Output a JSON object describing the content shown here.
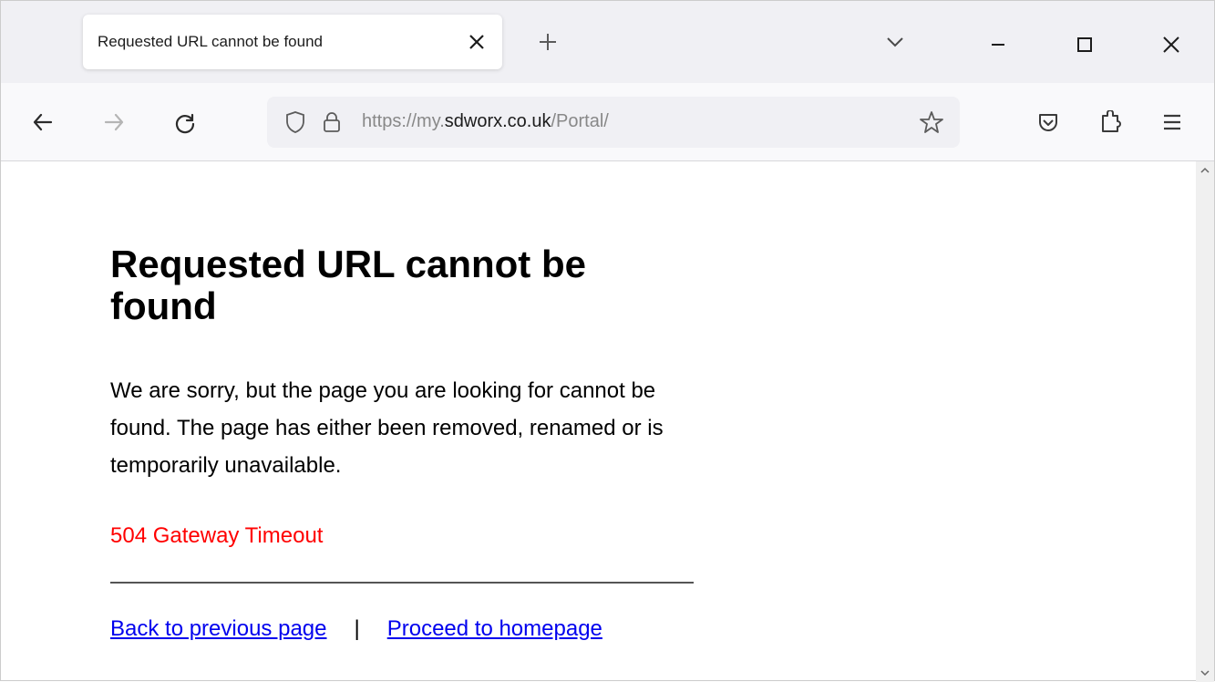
{
  "tab": {
    "title": "Requested URL cannot be found"
  },
  "address": {
    "url_prefix": "https://my.",
    "url_domain": "sdworx.co.uk",
    "url_suffix": "/Portal/"
  },
  "page": {
    "heading": "Requested URL cannot be found",
    "body": "We are sorry, but the page you are looking for cannot be found. The page has either been removed, renamed or is temporarily unavailable.",
    "error": "504 Gateway Timeout",
    "back_link": "Back to previous page",
    "separator": "|",
    "home_link": "Proceed to homepage"
  }
}
